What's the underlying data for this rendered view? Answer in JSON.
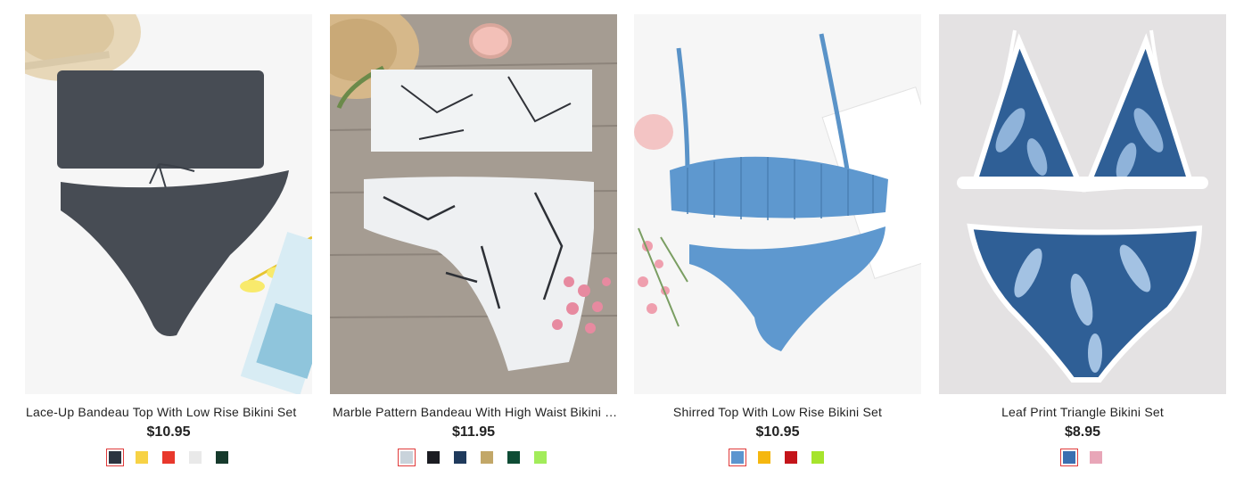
{
  "products": [
    {
      "title": "Lace-Up Bandeau Top With Low Rise Bikini Set",
      "price": "$10.95",
      "swatches": [
        {
          "color": "#2c3440",
          "selected": true
        },
        {
          "color": "#f7d245",
          "selected": false
        },
        {
          "color": "#e8382c",
          "selected": false
        },
        {
          "color": "#e9e9e9",
          "selected": false
        },
        {
          "color": "#163a2c",
          "selected": false
        }
      ]
    },
    {
      "title": "Marble Pattern Bandeau With High Waist Bikini Set",
      "price": "$11.95",
      "swatches": [
        {
          "color": "#c9d3db",
          "selected": true
        },
        {
          "color": "#1b1c22",
          "selected": false
        },
        {
          "color": "#1f3a5c",
          "selected": false
        },
        {
          "color": "#c2a768",
          "selected": false
        },
        {
          "color": "#0e4c35",
          "selected": false
        },
        {
          "color": "#a2ec5a",
          "selected": false
        }
      ]
    },
    {
      "title": "Shirred Top With Low Rise Bikini Set",
      "price": "$10.95",
      "swatches": [
        {
          "color": "#5b95cf",
          "selected": true
        },
        {
          "color": "#f5b70f",
          "selected": false
        },
        {
          "color": "#c4141a",
          "selected": false
        },
        {
          "color": "#a6e42c",
          "selected": false
        }
      ]
    },
    {
      "title": "Leaf Print Triangle Bikini Set",
      "price": "$8.95",
      "swatches": [
        {
          "color": "#3b6fb0",
          "selected": true
        },
        {
          "color": "#e8a6b8",
          "selected": false
        }
      ]
    }
  ]
}
